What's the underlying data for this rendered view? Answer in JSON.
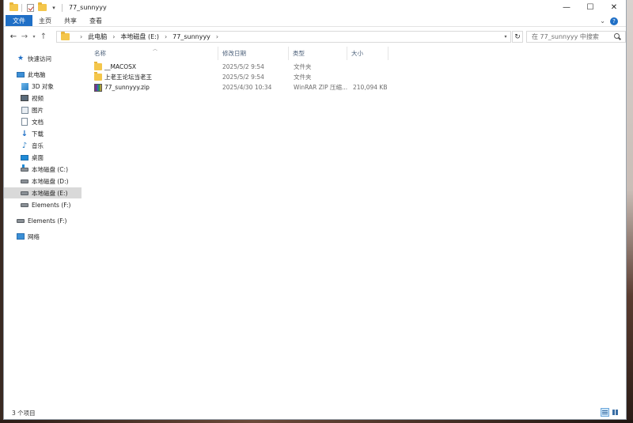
{
  "window": {
    "title": "77_sunnyyy",
    "controls": [
      "—",
      "☐",
      "✕"
    ]
  },
  "ribbon": {
    "tabs": [
      "文件",
      "主页",
      "共享",
      "查看"
    ],
    "expand_glyph": "⌄",
    "help_glyph": "?"
  },
  "address": {
    "crumbs": [
      "此电脑",
      "本地磁盘 (E:)",
      "77_sunnyyy"
    ],
    "search_placeholder": "在 77_sunnyyy 中搜索"
  },
  "sidebar": {
    "items": [
      {
        "label": "快速访问",
        "icon": "star-icon"
      },
      {
        "label": "此电脑",
        "icon": "computer-icon"
      },
      {
        "label": "3D 对象",
        "icon": "3d-objects-icon"
      },
      {
        "label": "视频",
        "icon": "video-icon"
      },
      {
        "label": "图片",
        "icon": "picture-icon"
      },
      {
        "label": "文档",
        "icon": "document-icon"
      },
      {
        "label": "下载",
        "icon": "download-icon"
      },
      {
        "label": "音乐",
        "icon": "music-icon"
      },
      {
        "label": "桌面",
        "icon": "desktop-icon"
      },
      {
        "label": "本地磁盘 (C:)",
        "icon": "drive-c-icon"
      },
      {
        "label": "本地磁盘 (D:)",
        "icon": "drive-icon"
      },
      {
        "label": "本地磁盘 (E:)",
        "icon": "drive-icon",
        "selected": true
      },
      {
        "label": "Elements (F:)",
        "icon": "drive-icon"
      },
      {
        "label": "Elements (F:)",
        "icon": "drive-icon"
      },
      {
        "label": "网络",
        "icon": "network-icon"
      }
    ]
  },
  "columns": [
    "名称",
    "修改日期",
    "类型",
    "大小"
  ],
  "files": [
    {
      "name": "__MACOSX",
      "modified": "2025/5/2 9:54",
      "type": "文件夹",
      "size": "",
      "icon": "folder-icon"
    },
    {
      "name": "上老王论坛当老王",
      "modified": "2025/5/2 9:54",
      "type": "文件夹",
      "size": "",
      "icon": "folder-icon"
    },
    {
      "name": "77_sunnyyy.zip",
      "modified": "2025/4/30 10:34",
      "type": "WinRAR ZIP 压缩...",
      "size": "210,094 KB",
      "icon": "winrar-zip-icon"
    }
  ],
  "status": {
    "item_count": "3 个项目"
  }
}
